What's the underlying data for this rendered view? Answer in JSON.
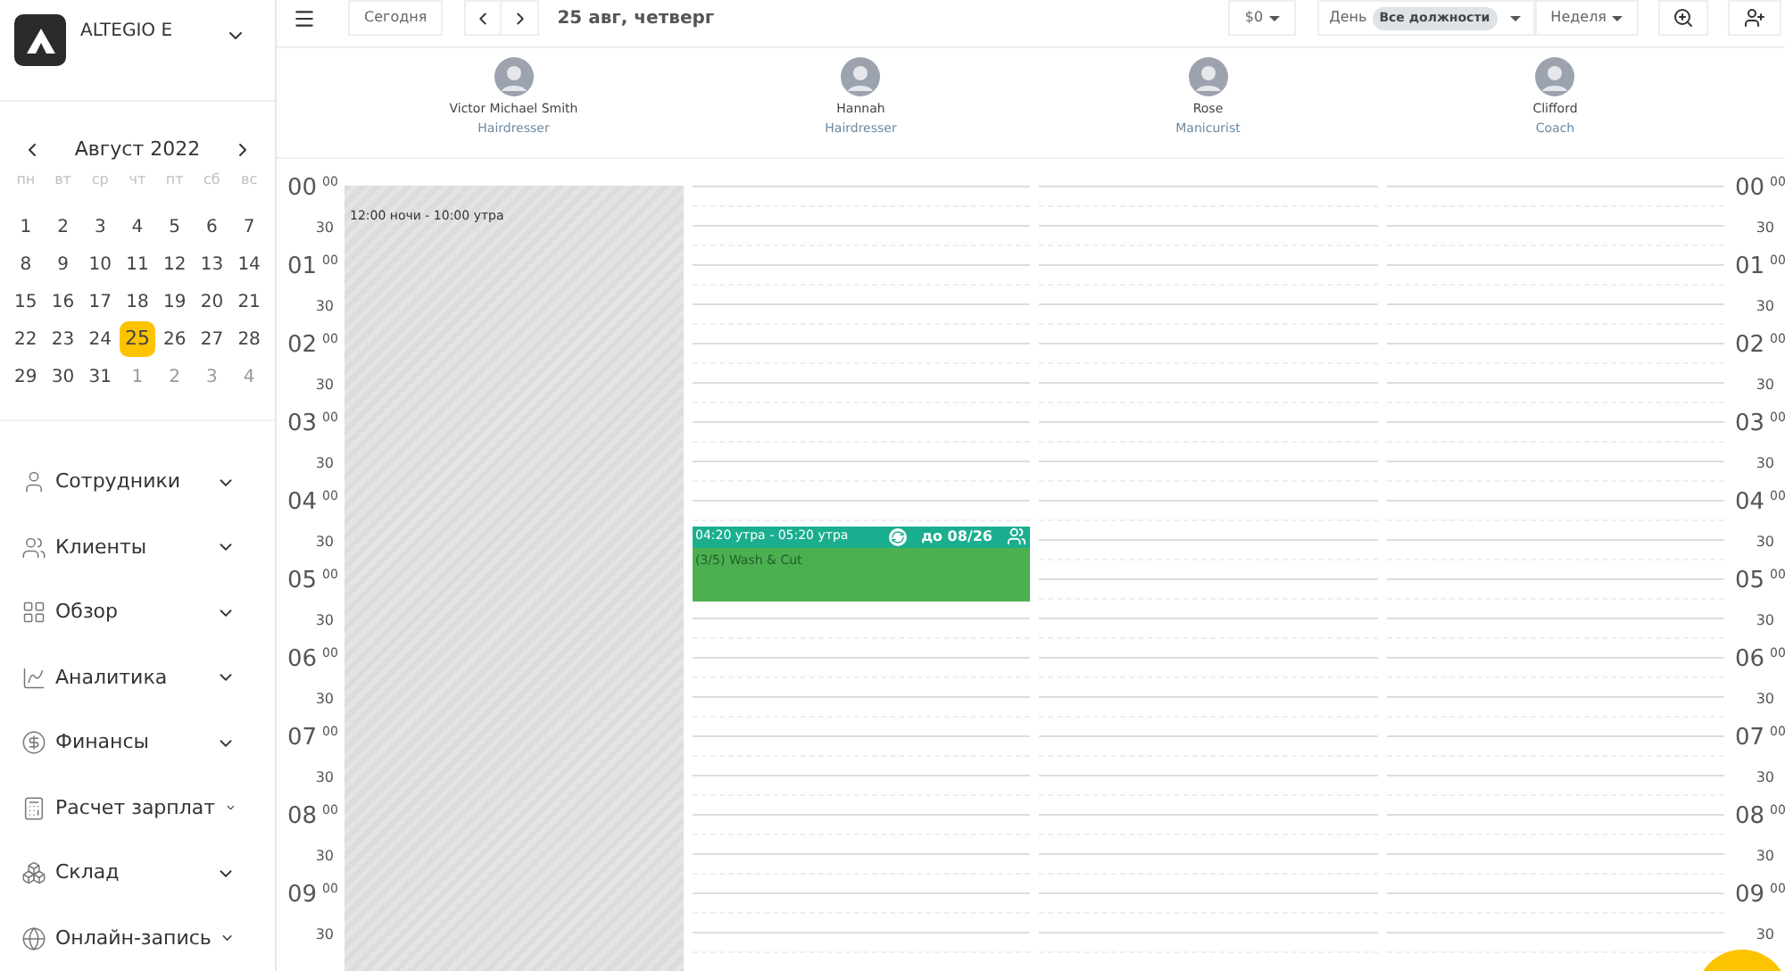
{
  "sidebar": {
    "brand": "ALTEGIO E",
    "calendar": {
      "month_label": "Август 2022",
      "weekdays": [
        "пн",
        "вт",
        "ср",
        "чт",
        "пт",
        "сб",
        "вс"
      ],
      "days": [
        {
          "label": "1",
          "muted": false,
          "selected": false
        },
        {
          "label": "2",
          "muted": false,
          "selected": false
        },
        {
          "label": "3",
          "muted": false,
          "selected": false
        },
        {
          "label": "4",
          "muted": false,
          "selected": false
        },
        {
          "label": "5",
          "muted": false,
          "selected": false
        },
        {
          "label": "6",
          "muted": false,
          "selected": false
        },
        {
          "label": "7",
          "muted": false,
          "selected": false
        },
        {
          "label": "8",
          "muted": false,
          "selected": false
        },
        {
          "label": "9",
          "muted": false,
          "selected": false
        },
        {
          "label": "10",
          "muted": false,
          "selected": false
        },
        {
          "label": "11",
          "muted": false,
          "selected": false
        },
        {
          "label": "12",
          "muted": false,
          "selected": false
        },
        {
          "label": "13",
          "muted": false,
          "selected": false
        },
        {
          "label": "14",
          "muted": false,
          "selected": false
        },
        {
          "label": "15",
          "muted": false,
          "selected": false
        },
        {
          "label": "16",
          "muted": false,
          "selected": false
        },
        {
          "label": "17",
          "muted": false,
          "selected": false
        },
        {
          "label": "18",
          "muted": false,
          "selected": false
        },
        {
          "label": "19",
          "muted": false,
          "selected": false
        },
        {
          "label": "20",
          "muted": false,
          "selected": false
        },
        {
          "label": "21",
          "muted": false,
          "selected": false
        },
        {
          "label": "22",
          "muted": false,
          "selected": false
        },
        {
          "label": "23",
          "muted": false,
          "selected": false
        },
        {
          "label": "24",
          "muted": false,
          "selected": false
        },
        {
          "label": "25",
          "muted": false,
          "selected": true
        },
        {
          "label": "26",
          "muted": false,
          "selected": false
        },
        {
          "label": "27",
          "muted": false,
          "selected": false
        },
        {
          "label": "28",
          "muted": false,
          "selected": false
        },
        {
          "label": "29",
          "muted": false,
          "selected": false
        },
        {
          "label": "30",
          "muted": false,
          "selected": false
        },
        {
          "label": "31",
          "muted": false,
          "selected": false
        },
        {
          "label": "1",
          "muted": true,
          "selected": false
        },
        {
          "label": "2",
          "muted": true,
          "selected": false
        },
        {
          "label": "3",
          "muted": true,
          "selected": false
        },
        {
          "label": "4",
          "muted": true,
          "selected": false
        }
      ]
    },
    "nav": [
      {
        "label": "Сотрудники",
        "kind": "user"
      },
      {
        "label": "Клиенты",
        "kind": "users"
      },
      {
        "label": "Обзор",
        "kind": "overview"
      },
      {
        "label": "Аналитика",
        "kind": "chart"
      },
      {
        "label": "Финансы",
        "kind": "money"
      },
      {
        "label": "Расчет зарплат",
        "kind": "payroll"
      },
      {
        "label": "Склад",
        "kind": "boxes"
      },
      {
        "label": "Онлайн-запись",
        "kind": "globe"
      }
    ]
  },
  "toolbar": {
    "today": "Сегодня",
    "date": "25 авг, четверг",
    "currency": "$0",
    "day": "День",
    "position_filter": "Все должности",
    "week": "Неделя"
  },
  "staff": [
    {
      "name": "Victor Michael Smith",
      "role": "Hairdresser",
      "blocks": [
        {
          "kind": "off",
          "label": "12:00 ночи - 10:00 утра"
        }
      ]
    },
    {
      "name": "Hannah",
      "role": "Hairdresser",
      "blocks": [
        {
          "kind": "appointment",
          "time": "04:20 утра - 05:20 утра",
          "until": "до 08/26",
          "title": "(3/5) Wash & Cut"
        }
      ]
    },
    {
      "name": "Rose",
      "role": "Manicurist"
    },
    {
      "name": "Clifford",
      "role": "Coach"
    }
  ],
  "left_times": [
    {
      "hour": "00",
      "minutes": "00",
      "half": "30"
    },
    {
      "hour": "01",
      "minutes": "00",
      "half": "30"
    },
    {
      "hour": "02",
      "minutes": "00",
      "half": "30"
    },
    {
      "hour": "03",
      "minutes": "00",
      "half": "30"
    },
    {
      "hour": "04",
      "minutes": "00",
      "half": "30"
    },
    {
      "hour": "05",
      "minutes": "00",
      "half": "30"
    },
    {
      "hour": "06",
      "minutes": "00",
      "half": "30"
    },
    {
      "hour": "07",
      "minutes": "00",
      "half": "30"
    },
    {
      "hour": "08",
      "minutes": "00",
      "half": "30"
    },
    {
      "hour": "09",
      "minutes": "00",
      "half": "30"
    }
  ],
  "right_times": [
    {
      "hour": "00",
      "minutes": "00",
      "half": "30"
    },
    {
      "hour": "01",
      "minutes": "00",
      "half": "30"
    },
    {
      "hour": "02",
      "minutes": "00",
      "half": "30"
    },
    {
      "hour": "03",
      "minutes": "00",
      "half": "30"
    },
    {
      "hour": "04",
      "minutes": "00",
      "half": "30"
    },
    {
      "hour": "05",
      "minutes": "00",
      "half": "30"
    },
    {
      "hour": "06",
      "minutes": "00",
      "half": "30"
    },
    {
      "hour": "07",
      "minutes": "00",
      "half": "30"
    },
    {
      "hour": "08",
      "minutes": "00",
      "half": "30"
    },
    {
      "hour": "09",
      "minutes": "00",
      "half": "30"
    }
  ]
}
